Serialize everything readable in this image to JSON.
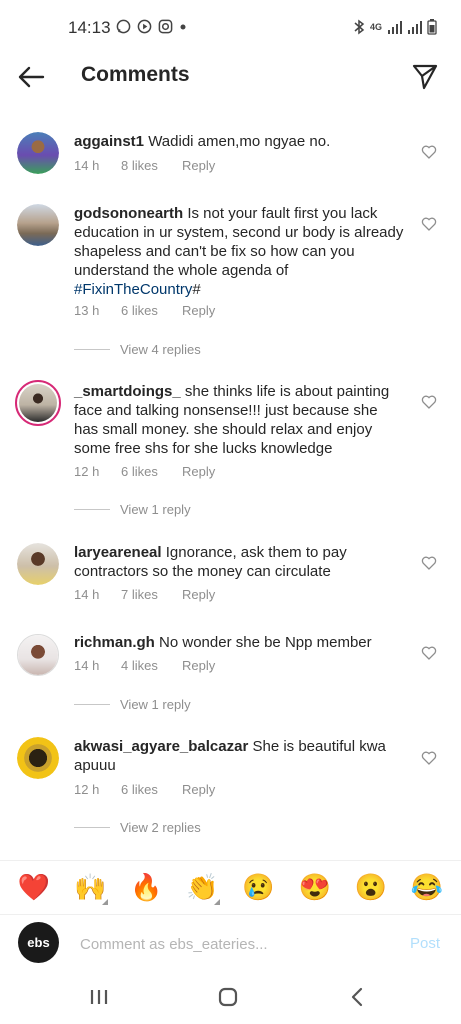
{
  "status_bar": {
    "time": "14:13",
    "left_icons": [
      "whatsapp-icon",
      "play-icon",
      "instagram-icon",
      "dot"
    ],
    "right_icons": [
      "bluetooth-icon",
      "4g-icon",
      "signal-icon",
      "signal-icon",
      "battery-icon"
    ],
    "network": "4G"
  },
  "header": {
    "title": "Comments"
  },
  "comments": [
    {
      "username": "aggainst1",
      "text": "Wadidi amen,mo ngyae no.",
      "time": "14 h",
      "likes": "8 likes",
      "reply": "Reply"
    },
    {
      "username": "godsononearth",
      "text": "Is not your fault first you lack education in ur system, second ur body is already shapeless and can't be fix so how can you understand the whole agenda of ",
      "hashtag": "#FixinTheCountry",
      "text_after": "#",
      "time": "13 h",
      "likes": "6 likes",
      "reply": "Reply",
      "view_replies": "View 4 replies"
    },
    {
      "username": "_smartdoings_",
      "text": "she thinks life is about painting face and talking nonsense!!! just because she has small money. she should relax and enjoy some free shs for she lucks knowledge",
      "time": "12 h",
      "likes": "6 likes",
      "reply": "Reply",
      "view_replies": "View 1 reply"
    },
    {
      "username": "laryeareneal",
      "text": "Ignorance,  ask them to pay contractors so the money can circulate",
      "time": "14 h",
      "likes": "7 likes",
      "reply": "Reply"
    },
    {
      "username": "richman.gh",
      "text": "No wonder she be Npp member",
      "time": "14 h",
      "likes": "4 likes",
      "reply": "Reply",
      "view_replies": "View 1 reply"
    },
    {
      "username": "akwasi_agyare_balcazar",
      "text": "She is beautiful kwa apuuu",
      "time": "12 h",
      "likes": "6 likes",
      "reply": "Reply",
      "view_replies": "View 2 replies"
    }
  ],
  "emoji_bar": [
    "❤️",
    "🙌",
    "🔥",
    "👏",
    "😢",
    "😍",
    "😮",
    "😂"
  ],
  "input": {
    "avatar_text": "ebs",
    "placeholder": "Comment as ebs_eateries...",
    "post_label": "Post"
  },
  "colors": {
    "text": "#262626",
    "secondary": "#8e8e8e",
    "link": "#00376b",
    "post_disabled": "#b2dffc",
    "story_ring": "#d62976"
  }
}
